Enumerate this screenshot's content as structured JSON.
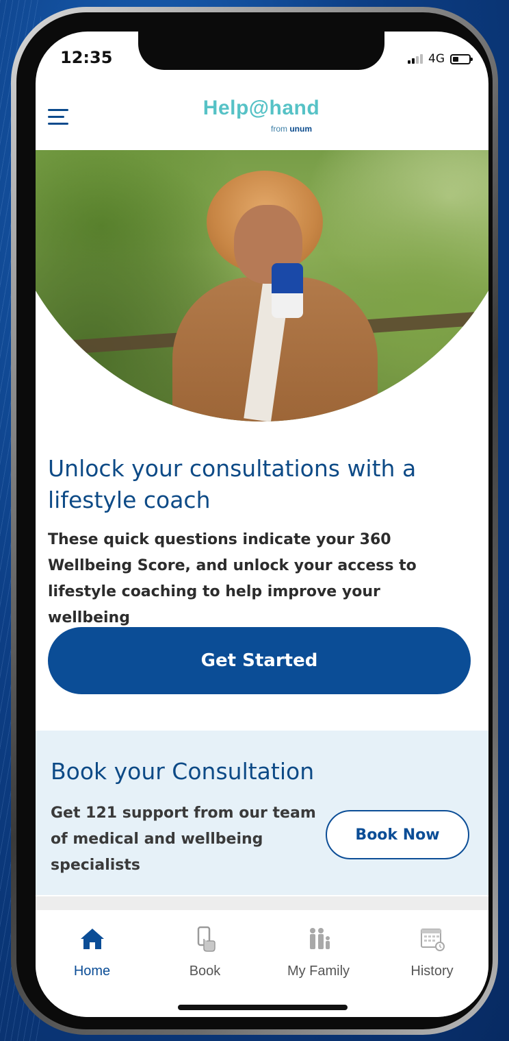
{
  "status_bar": {
    "time": "12:35",
    "network": "4G"
  },
  "header": {
    "logo_main": "Help@hand",
    "logo_from": "from",
    "logo_brand": "unum"
  },
  "hero": {
    "title": "Unlock your consultations with a lifestyle coach",
    "description": "These quick questions indicate your 360 Wellbeing Score, and unlock your access to lifestyle coaching to help improve your wellbeing",
    "cta_label": "Get Started"
  },
  "book": {
    "title": "Book your Consultation",
    "description": "Get 121 support from our team of medical and wellbeing specialists",
    "button_label": "Book Now"
  },
  "tabs": [
    {
      "label": "Home",
      "icon": "home-icon",
      "active": true
    },
    {
      "label": "Book",
      "icon": "phone-tap-icon",
      "active": false
    },
    {
      "label": "My Family",
      "icon": "family-icon",
      "active": false
    },
    {
      "label": "History",
      "icon": "calendar-clock-icon",
      "active": false
    }
  ],
  "colors": {
    "primary": "#0b4d96",
    "teal": "#56c2c6",
    "section_bg": "#e6f1f8",
    "title": "#0d4a86"
  }
}
